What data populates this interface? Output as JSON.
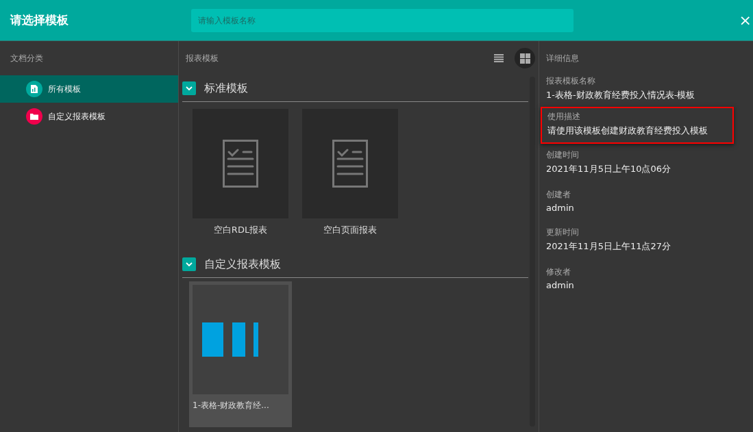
{
  "header": {
    "title": "请选择模板",
    "search": {
      "placeholder": "请输入模板名称"
    },
    "close": "×"
  },
  "sidebar": {
    "heading": "文档分类",
    "items": [
      {
        "label": "所有模板",
        "selected": true,
        "kind": "all",
        "color": "#00a99d"
      },
      {
        "label": "自定义报表模板",
        "selected": false,
        "kind": "folder",
        "color": "#f0004c"
      }
    ]
  },
  "templates": {
    "heading": "报表模板",
    "view_modes": [
      {
        "kind": "list",
        "selected": false
      },
      {
        "kind": "grid",
        "selected": true
      }
    ],
    "groups": [
      {
        "title": "标准模板",
        "expanded": true,
        "items": [
          {
            "label": "空白RDL报表",
            "kind": "blank",
            "selected": false
          },
          {
            "label": "空白页面报表",
            "kind": "blank",
            "selected": false
          }
        ]
      },
      {
        "title": "自定义报表模板",
        "expanded": true,
        "items": [
          {
            "label": "1-表格-财政教育经...",
            "kind": "custom",
            "selected": true
          }
        ]
      }
    ]
  },
  "details": {
    "heading": "详细信息",
    "fields": [
      {
        "label": "报表模板名称",
        "value": "1-表格-财政教育经费投入情况表-模板",
        "highlighted": false
      },
      {
        "label": "使用描述",
        "value": "请使用该模板创建财政教育经费投入模板",
        "highlighted": true
      },
      {
        "label": "创建时间",
        "value": "2021年11月5日上午10点06分",
        "highlighted": false
      },
      {
        "label": "创建者",
        "value": "admin",
        "highlighted": false
      },
      {
        "label": "更新时间",
        "value": "2021年11月5日上午11点27分",
        "highlighted": false
      },
      {
        "label": "修改者",
        "value": "admin",
        "highlighted": false
      }
    ]
  }
}
